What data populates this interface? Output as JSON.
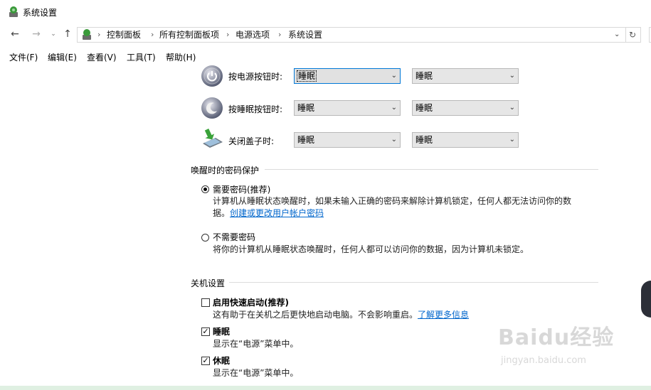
{
  "window": {
    "title": "系统设置"
  },
  "address": {
    "crumbs": [
      "控制面板",
      "所有控制面板项",
      "电源选项",
      "系统设置"
    ]
  },
  "menu": [
    "文件(F)",
    "编辑(E)",
    "查看(V)",
    "工具(T)",
    "帮助(H)"
  ],
  "power_rows": [
    {
      "label": "按电源按钮时:",
      "battery": "睡眠",
      "plugged": "睡眠"
    },
    {
      "label": "按睡眠按钮时:",
      "battery": "睡眠",
      "plugged": "睡眠"
    },
    {
      "label": "关闭盖子时:",
      "battery": "睡眠",
      "plugged": "睡眠"
    }
  ],
  "password": {
    "heading": "唤醒时的密码保护",
    "require_label": "需要密码(推荐)",
    "require_desc_1": "计算机从睡眠状态唤醒时，如果未输入正确的密码来解除计算机锁定，任何人都无法访问你的数",
    "require_desc_2": "据。",
    "require_link": "创建或更改用户帐户密码",
    "norequire_label": "不需要密码",
    "norequire_desc": "将你的计算机从睡眠状态唤醒时，任何人都可以访问你的数据，因为计算机未锁定。"
  },
  "shutdown": {
    "heading": "关机设置",
    "fast_label": "启用快速启动(推荐)",
    "fast_desc": "这有助于在关机之后更快地启动电脑。不会影响重启。",
    "fast_link": "了解更多信息",
    "sleep_label": "睡眠",
    "sleep_desc": "显示在“电源”菜单中。",
    "hibernate_label": "休眠",
    "hibernate_desc": "显示在“电源”菜单中。"
  },
  "watermark": {
    "logo": "Baidu经验",
    "url": "jingyan.baidu.com"
  },
  "colors": {
    "link": "#0066cc",
    "focus": "#0078d7",
    "combo_bg": "#e6e6e6"
  }
}
